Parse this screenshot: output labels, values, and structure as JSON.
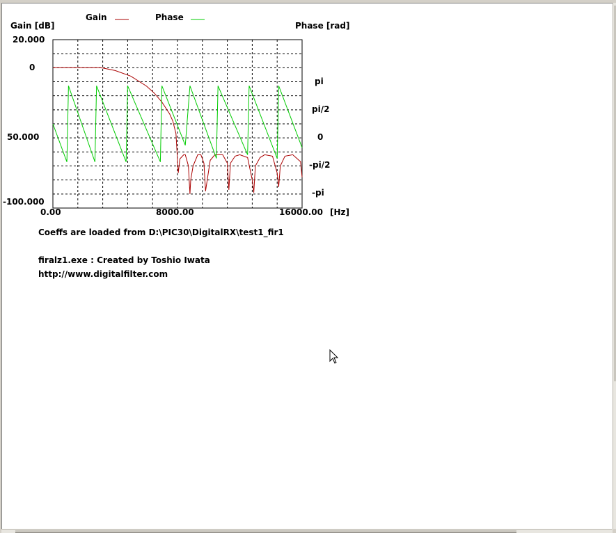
{
  "legend": {
    "gain_label": "Gain",
    "phase_label": "Phase",
    "gain_color": "#aa0000",
    "phase_color": "#00cc00"
  },
  "axes": {
    "gain_axis_label": "Gain [dB]",
    "phase_axis_label": "Phase [rad]",
    "freq_unit_label": "[Hz]",
    "gain_ticks": [
      "20.000",
      "0",
      "50.000",
      "-100.000"
    ],
    "phase_ticks": [
      "pi",
      "pi/2",
      "0",
      "-pi/2",
      "-pi"
    ],
    "freq_ticks": [
      "0.00",
      "8000.00",
      "16000.00"
    ]
  },
  "info": {
    "coeffs_line": "Coeffs are loaded from D:\\PIC30\\DigitalRX\\test1_fir1",
    "created_line": "firalz1.exe : Created by Toshio Iwata",
    "url_line": "http://www.digitalfilter.com"
  },
  "chart_data": {
    "type": "line",
    "xlabel": "[Hz]",
    "ylabel": "Gain [dB]",
    "y2label": "Phase [rad]",
    "xlim": [
      0,
      16000
    ],
    "ylim": [
      -100,
      20
    ],
    "y2lim": [
      -3.54,
      3.54
    ],
    "grid": true,
    "legend_position": "top",
    "series": [
      {
        "name": "Gain",
        "axis": "left",
        "x": [
          0,
          1000,
          2000,
          3000,
          3200,
          4000,
          5000,
          6000,
          6500,
          7000,
          7500,
          7700,
          7900,
          8050,
          8150,
          8400,
          8500,
          8700,
          8750,
          8800,
          8850,
          9000,
          9300,
          9500,
          9700,
          9800,
          10100,
          10400,
          10900,
          11200,
          11300,
          11400,
          11700,
          12000,
          12500,
          12800,
          12900,
          13000,
          13300,
          13600,
          14100,
          14400,
          14500,
          14600,
          14900,
          15400,
          15900,
          16000
        ],
        "values": [
          0,
          0,
          0,
          0,
          -0.2,
          -2,
          -6,
          -13,
          -18,
          -24.5,
          -33,
          -38,
          -47,
          -75,
          -65,
          -62,
          -62,
          -70,
          -80,
          -90,
          -80,
          -70,
          -62,
          -62,
          -68,
          -88,
          -66,
          -62,
          -62,
          -68,
          -87,
          -68,
          -63,
          -62,
          -64,
          -80,
          -89,
          -70,
          -64,
          -62,
          -63,
          -75,
          -85,
          -70,
          -63,
          -62,
          -67,
          -78
        ]
      },
      {
        "name": "Phase",
        "axis": "right",
        "x": [
          0,
          900,
          1000,
          2700,
          2800,
          4700,
          4800,
          6900,
          7000,
          8500,
          8800,
          10500,
          10600,
          12500,
          12600,
          14400,
          14500,
          16000
        ],
        "values": [
          0,
          -1.6,
          1.6,
          -1.6,
          1.6,
          -1.6,
          1.6,
          -1.6,
          1.6,
          -0.9,
          1.6,
          -1.45,
          1.6,
          -1.3,
          1.6,
          -1.45,
          1.6,
          -1.0
        ]
      }
    ]
  }
}
